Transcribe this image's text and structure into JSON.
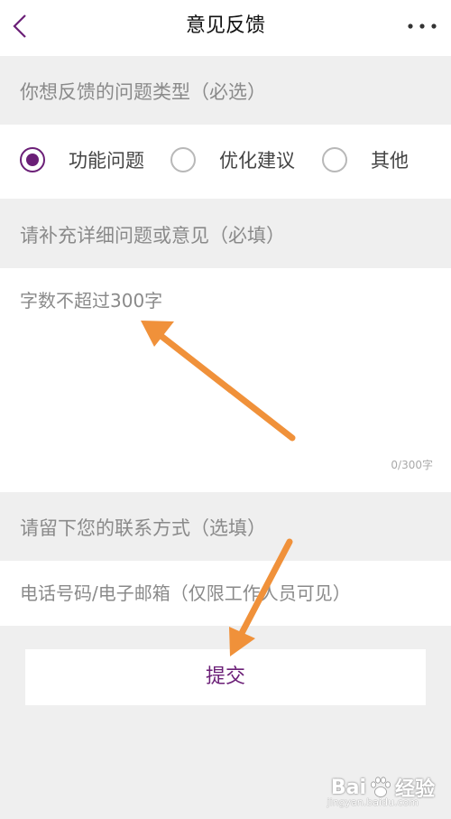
{
  "header": {
    "title": "意见反馈"
  },
  "issue_type": {
    "label": "你想反馈的问题类型（必选）",
    "options": [
      {
        "label": "功能问题",
        "selected": true
      },
      {
        "label": "优化建议",
        "selected": false
      },
      {
        "label": "其他",
        "selected": false
      }
    ]
  },
  "details": {
    "label": "请补充详细问题或意见（必填）",
    "placeholder": "字数不超过300字",
    "counter": "0/300字"
  },
  "contact": {
    "label": "请留下您的联系方式（选填）",
    "placeholder": "电话号码/电子邮箱（仅限工作人员可见）"
  },
  "submit_label": "提交",
  "watermark": {
    "brand_left": "Bai",
    "brand_right": "经验",
    "sub": "jingyan.baidu.com"
  },
  "colors": {
    "accent": "#6b1f77",
    "arrow": "#f0913a",
    "background": "#efefef"
  }
}
